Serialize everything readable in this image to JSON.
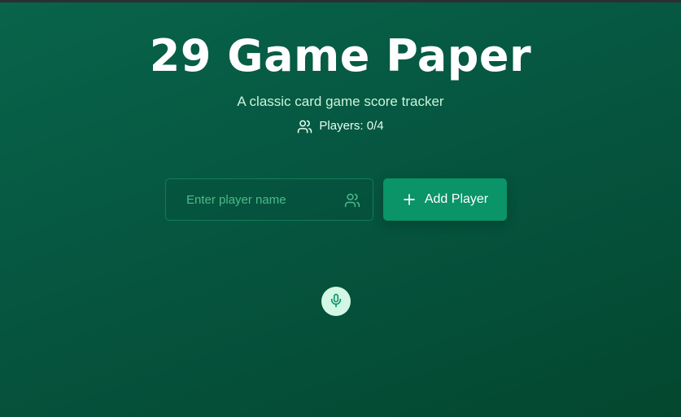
{
  "header": {
    "title": "29 Game Paper",
    "subtitle": "A classic card game score tracker",
    "players_label": "Players: 0/4"
  },
  "form": {
    "name_placeholder": "Enter player name",
    "name_value": "",
    "add_button_label": "Add Player"
  },
  "icons": {
    "players": "users-icon",
    "field": "users-icon",
    "add": "plus-icon",
    "voice": "microphone-icon"
  },
  "colors": {
    "background": "#065640",
    "button": "#0a9467",
    "mic_background": "#d2f7e4",
    "mic_icon": "#0a9467"
  }
}
